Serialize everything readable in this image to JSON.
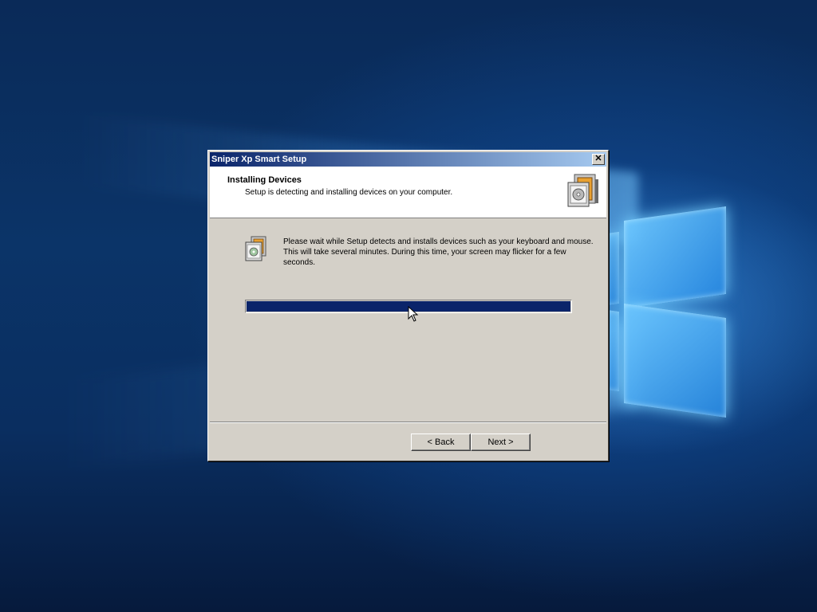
{
  "desktop": {
    "background": "windows-10-hero",
    "accent": "#1f78d1"
  },
  "dialog": {
    "title": "Sniper Xp Smart Setup",
    "close_icon": "close-icon",
    "header": {
      "title": "Installing Devices",
      "subtitle": "Setup is detecting and installing devices on your computer.",
      "icon": "setup-box-icon"
    },
    "body": {
      "icon": "device-install-icon",
      "message": "Please wait while Setup detects and installs devices such as your keyboard and mouse.  This will take several minutes.  During this time, your screen may flicker for a few seconds.",
      "progress_percent": 100,
      "progress_color": "#0a246a"
    },
    "buttons": {
      "back_label": "< Back",
      "next_label": "Next >"
    }
  }
}
